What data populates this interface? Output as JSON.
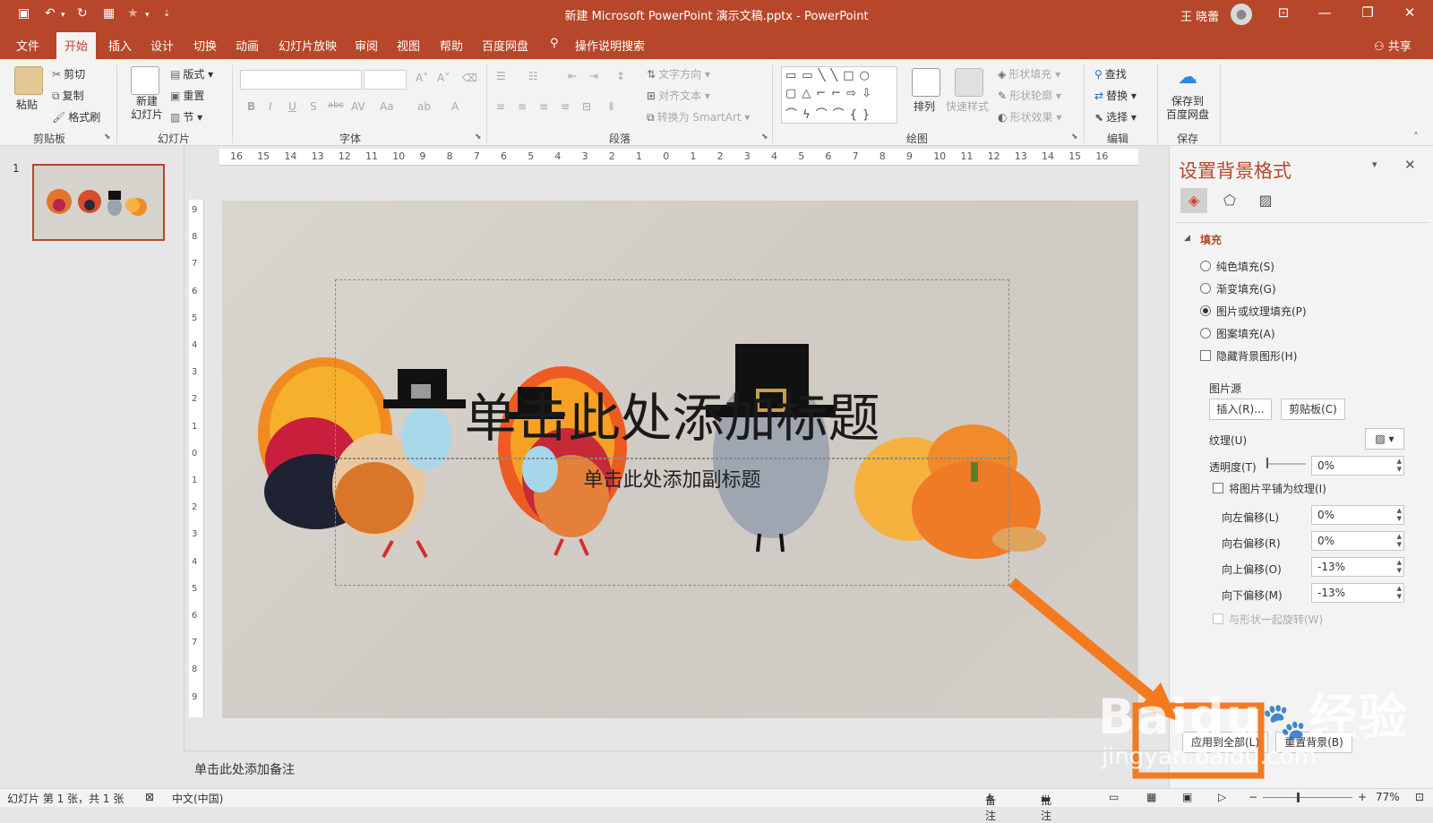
{
  "window": {
    "title": "新建 Microsoft PowerPoint 演示文稿.pptx  -  PowerPoint",
    "user": "王 晓蕾"
  },
  "tabs": [
    "文件",
    "开始",
    "插入",
    "设计",
    "切换",
    "动画",
    "幻灯片放映",
    "审阅",
    "视图",
    "帮助",
    "百度网盘"
  ],
  "active_tab": "开始",
  "tell_me": "操作说明搜索",
  "share": "共享",
  "ribbon": {
    "clipboard": {
      "label": "剪贴板",
      "paste": "粘贴",
      "cut": "剪切",
      "copy": "复制",
      "format_painter": "格式刷"
    },
    "slides": {
      "label": "幻灯片",
      "new_slide": "新建\n幻灯片",
      "layout": "版式",
      "reset": "重置",
      "section": "节"
    },
    "font": {
      "label": "字体"
    },
    "paragraph": {
      "label": "段落",
      "text_direction": "文字方向",
      "align_text": "对齐文本",
      "smartart": "转换为 SmartArt"
    },
    "drawing": {
      "label": "绘图",
      "arrange": "排列",
      "quick_styles": "快速样式",
      "shape_fill": "形状填充",
      "shape_outline": "形状轮廓",
      "shape_effects": "形状效果"
    },
    "editing": {
      "label": "编辑",
      "find": "查找",
      "replace": "替换",
      "select": "选择"
    },
    "save": {
      "label": "保存",
      "save_to_baidu": "保存到\n百度网盘"
    }
  },
  "thumbnail_number": "1",
  "ruler_h": [
    "16",
    "15",
    "14",
    "13",
    "12",
    "11",
    "10",
    "9",
    "8",
    "7",
    "6",
    "5",
    "4",
    "3",
    "2",
    "1",
    "0",
    "1",
    "2",
    "3",
    "4",
    "5",
    "6",
    "7",
    "8",
    "9",
    "10",
    "11",
    "12",
    "13",
    "14",
    "15",
    "16"
  ],
  "ruler_v": [
    "9",
    "8",
    "7",
    "6",
    "5",
    "4",
    "3",
    "2",
    "1",
    "0",
    "1",
    "2",
    "3",
    "4",
    "5",
    "6",
    "7",
    "8",
    "9"
  ],
  "slide": {
    "title_placeholder": "单击此处添加标题",
    "subtitle_placeholder": "单击此处添加副标题"
  },
  "notes_placeholder": "单击此处添加备注",
  "format_pane": {
    "title": "设置背景格式",
    "section_fill": "填充",
    "options": [
      "纯色填充(S)",
      "渐变填充(G)",
      "图片或纹理填充(P)",
      "图案填充(A)"
    ],
    "selected_option": "图片或纹理填充(P)",
    "hide_background": "隐藏背景图形(H)",
    "picture_source": "图片源",
    "insert_button": "插入(R)...",
    "clipboard_button": "剪贴板(C)",
    "texture_label": "纹理(U)",
    "transparency_label": "透明度(T)",
    "transparency_value": "0%",
    "tile_label": "将图片平铺为纹理(I)",
    "offsets": [
      {
        "label": "向左偏移(L)",
        "value": "0%"
      },
      {
        "label": "向右偏移(R)",
        "value": "0%"
      },
      {
        "label": "向上偏移(O)",
        "value": "-13%"
      },
      {
        "label": "向下偏移(M)",
        "value": "-13%"
      }
    ],
    "rotate_with_shape": "与形状一起旋转(W)",
    "apply_all_button": "应用到全部(L)",
    "reset_button": "重置背景(B)"
  },
  "watermark": {
    "brand": "Baidu",
    "cn": "经验",
    "url": "jingyan.baidu.com"
  },
  "status": {
    "slide_info": "幻灯片 第 1 张，共 1 张",
    "language": "中文(中国)",
    "notes": "备注",
    "comments": "批注",
    "zoom": "77%"
  },
  "colors": {
    "accent": "#b7472a",
    "highlight": "#f47a20"
  }
}
